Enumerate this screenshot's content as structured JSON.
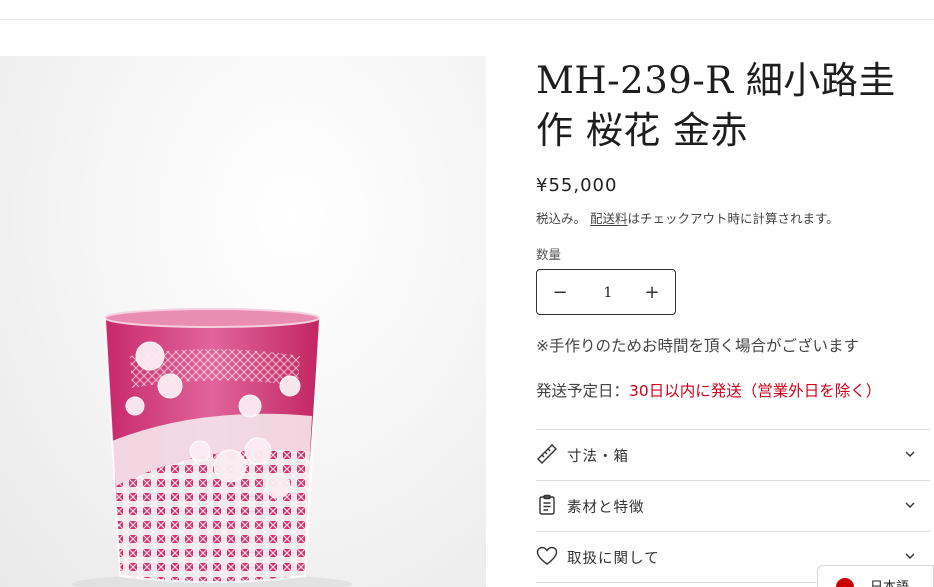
{
  "product": {
    "title": "MH-239-R 細小路圭作 桜花 金赤",
    "price": "¥55,000",
    "tax_prefix": "税込み。",
    "tax_link": "配送料",
    "tax_suffix": "はチェックアウト時に計算されます。",
    "quantity_label": "数量",
    "quantity_value": "1",
    "quantity_decrease": "−",
    "quantity_increase": "+",
    "handmade_note": "※手作りのためお時間を頂く場合がございます",
    "shipping_label": "発送予定日：",
    "shipping_value": "30日以内に発送（営業外日を除く）"
  },
  "accordion": [
    {
      "label": "寸法・箱",
      "icon": "ruler-icon"
    },
    {
      "label": "素材と特徴",
      "icon": "clipboard-icon"
    },
    {
      "label": "取扱に関して",
      "icon": "heart-icon"
    }
  ],
  "language_selector": {
    "label": "日本語",
    "icon": "japan-flag-icon"
  },
  "colors": {
    "glass_pink": "#d63a78",
    "shipping_red": "#d0021b",
    "text": "#222222"
  }
}
